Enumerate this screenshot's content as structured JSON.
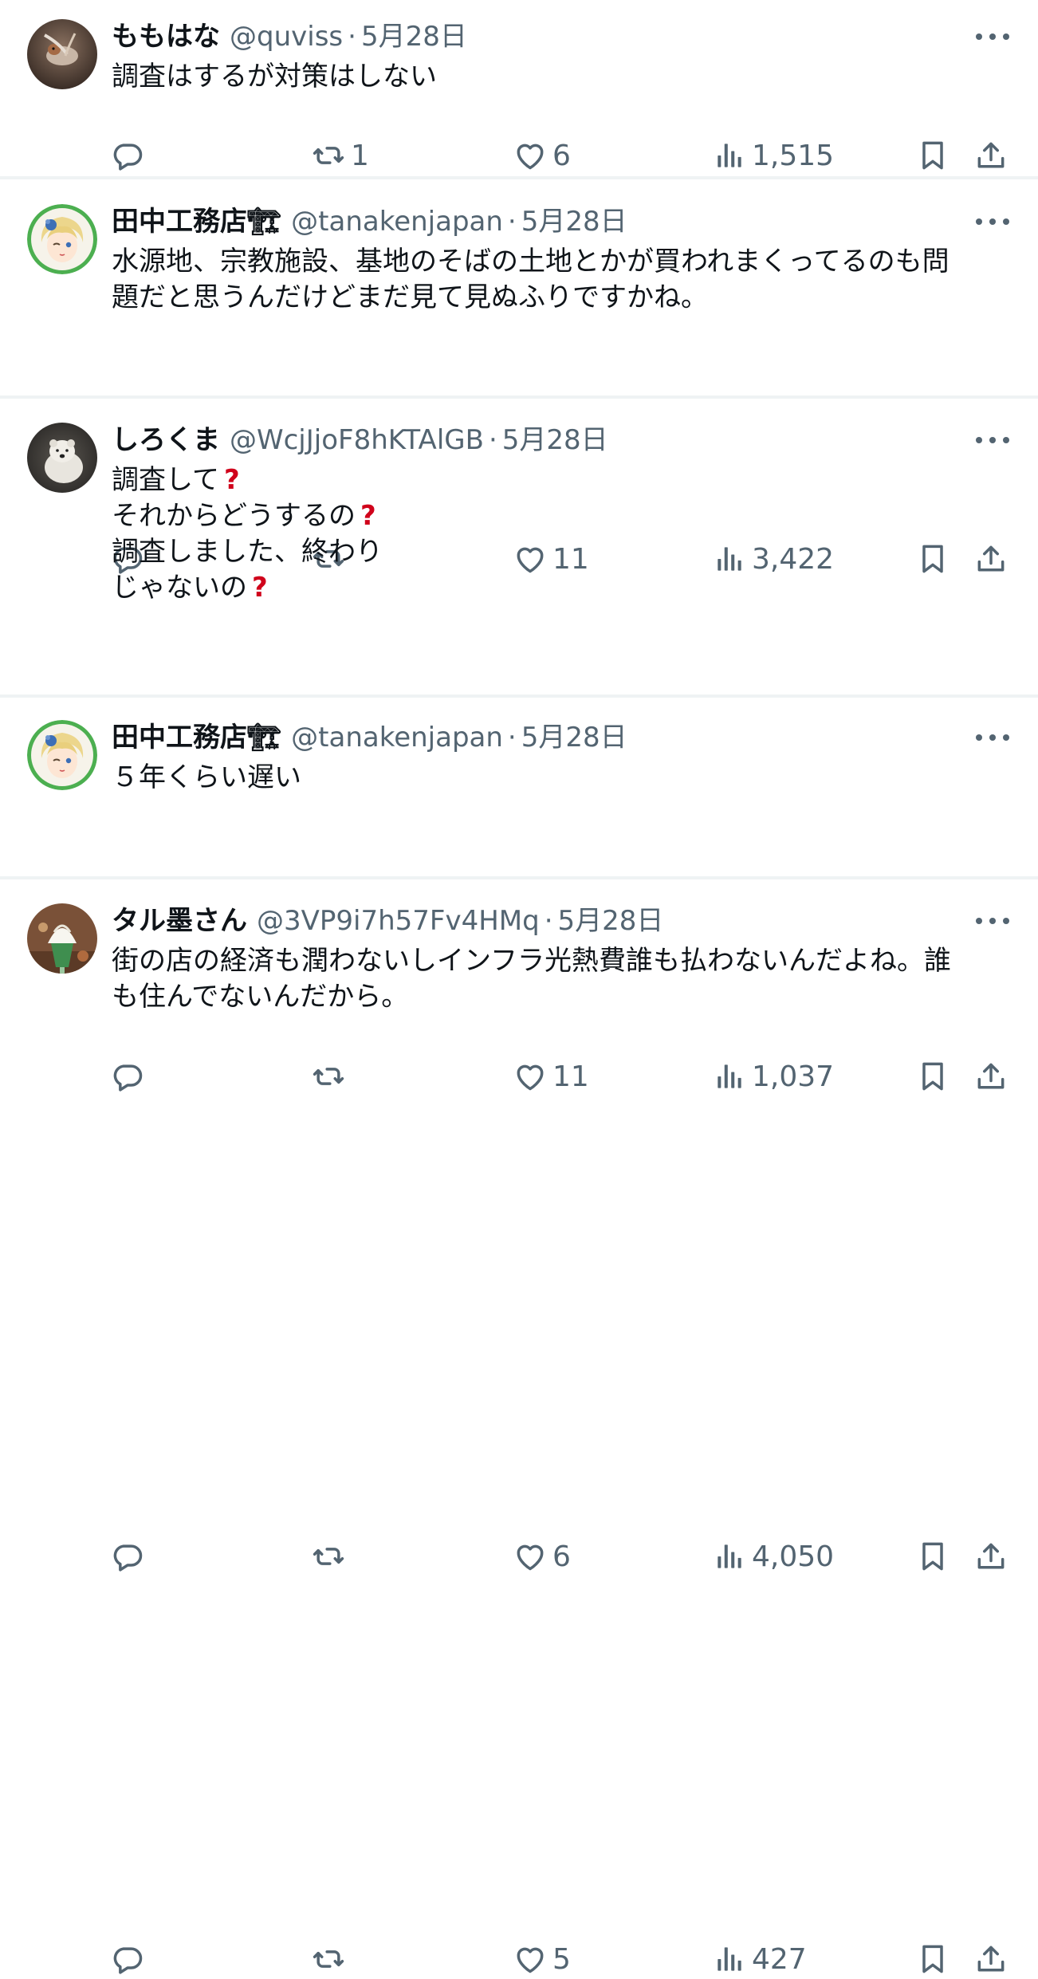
{
  "posts": [
    {
      "name": "ももはな",
      "handle": "@quviss",
      "sep": "·",
      "date": "5月28日",
      "text_lines": [
        "調査はするが対策はしない"
      ],
      "avatar": "bird-photo",
      "replies": "",
      "reposts": "1",
      "likes": "6",
      "views": "1,515"
    },
    {
      "name": "田中工務店🏗",
      "handle": "@tanakenjapan",
      "sep": "·",
      "date": "5月28日",
      "text_lines": [
        "水源地、宗教施設、基地のそばの土地とかが買われまくってるのも問",
        "題だと思うんだけどまだ見て見ぬふりですかね。"
      ],
      "avatar": "anime-girl",
      "replies": "",
      "reposts": "",
      "likes": "11",
      "views": "3,422"
    },
    {
      "name": "しろくま",
      "handle": "@WcjJjoF8hKTAlGB",
      "sep": "·",
      "date": "5月28日",
      "text_lines": [
        "調査して",
        "それからどうするの",
        "調査しました、終わり",
        "じゃないの"
      ],
      "qmark_lines": [
        true,
        true,
        false,
        true
      ],
      "qmark": "?",
      "avatar": "polar-bear",
      "replies": "",
      "reposts": "",
      "likes": "11",
      "views": "1,037"
    },
    {
      "name": "田中工務店🏗",
      "handle": "@tanakenjapan",
      "sep": "·",
      "date": "5月28日",
      "text_lines": [
        "５年くらい遅い"
      ],
      "avatar": "anime-girl",
      "replies": "",
      "reposts": "",
      "likes": "6",
      "views": "4,050"
    },
    {
      "name": "タル墨さん",
      "handle": "@3VP9i7h57Fv4HMq",
      "sep": "·",
      "date": "5月28日",
      "text_lines": [
        "街の店の経済も潤わないしインフラ光熱費誰も払わないんだよね。誰",
        "も住んでないんだから。"
      ],
      "avatar": "parfait",
      "replies": "",
      "reposts": "",
      "likes": "5",
      "views": "427"
    }
  ],
  "colors": {
    "text": "#0f1419",
    "secondary": "#536471",
    "separator": "#eff3f4",
    "qmark": "#d0021b"
  },
  "icons": [
    "reply-icon",
    "repost-icon",
    "like-icon",
    "views-icon",
    "bookmark-icon",
    "share-icon",
    "more-icon"
  ]
}
